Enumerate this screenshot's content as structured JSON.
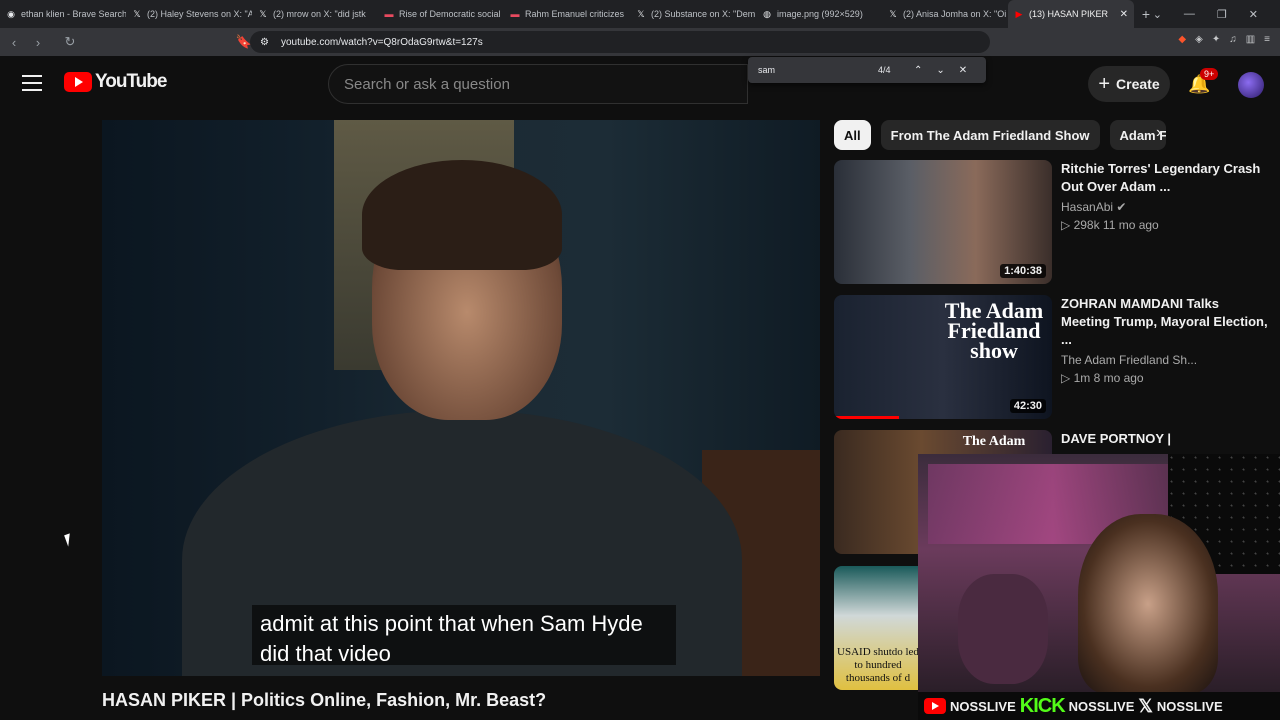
{
  "browser": {
    "tabs": [
      {
        "title": "ethan klien - Brave Search",
        "icon": "brave-icon"
      },
      {
        "title": "(2) Haley Stevens on X: \"A",
        "icon": "x-icon"
      },
      {
        "title": "(2) mrow on X: \"did jstk",
        "icon": "x-icon"
      },
      {
        "title": "Rise of Democratic social",
        "icon": "red-icon"
      },
      {
        "title": "Rahm Emanuel criticizes",
        "icon": "red-icon"
      },
      {
        "title": "(2) Substance on X: \"Dem",
        "icon": "x-icon"
      },
      {
        "title": "image.png (992×529)",
        "icon": "globe-icon"
      },
      {
        "title": "(2) Anisa Jomha on X: \"Oi",
        "icon": "x-icon"
      },
      {
        "title": "(13) HASAN PIKER",
        "icon": "youtube-icon",
        "active": true
      }
    ],
    "url": "youtube.com/watch?v=Q8rOdaG9rtw&t=127s"
  },
  "findbar": {
    "query": "sam",
    "count": "4/4"
  },
  "youtube": {
    "logo_text": "YouTube",
    "search_placeholder": "Search or ask a question",
    "create_label": "Create",
    "notif_count": "9+",
    "chips": [
      "All",
      "From The Adam Friedland Show",
      "Adam F"
    ],
    "caption_line1": "admit at this point that when Sam Hyde",
    "caption_line2": "did that video",
    "video_title": "HASAN PIKER | Politics Online, Fashion, Mr. Beast?",
    "related": [
      {
        "title": "Ritchie Torres' Legendary Crash Out Over Adam ...",
        "channel": "HasanAbi",
        "verified": true,
        "stats": "▷ 298k  11 mo ago",
        "duration": "1:40:38"
      },
      {
        "title": "ZOHRAN MAMDANI Talks Meeting Trump, Mayoral Election, ...",
        "channel": "The Adam Friedland Sh...",
        "stats": "▷ 1m  8 mo ago",
        "duration": "42:30",
        "thumb_text": "The Adam Friedland show",
        "progress": 0.3
      },
      {
        "title": "DAVE PORTNOY |",
        "channel": "",
        "stats": "",
        "duration": "",
        "thumb_text": "The Adam Friedland"
      },
      {
        "title": "",
        "channel": "",
        "stats": "",
        "duration": "",
        "thumb_text": "USAID shutdo led to hundred thousands of d"
      }
    ]
  },
  "overlay": {
    "handle1": "NOSSLIVE",
    "handle2": "NOSSLIVE",
    "handle3": "NOSSLIVE",
    "kick_label": "KICK"
  },
  "colors": {
    "accent": "#ff0000",
    "kick": "#53fc18"
  }
}
